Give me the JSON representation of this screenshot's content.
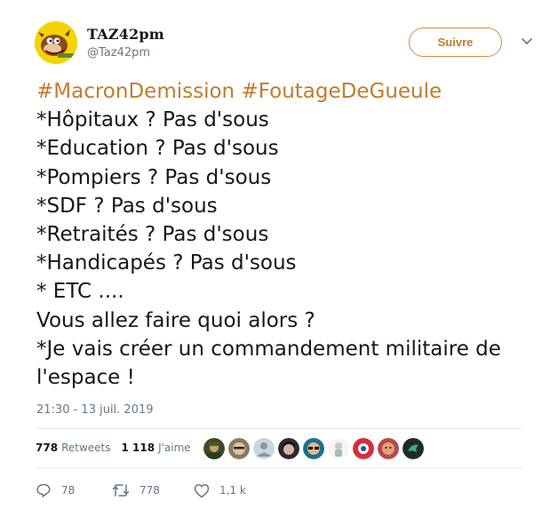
{
  "user": {
    "display_name": "TAZ42pm",
    "handle": "@Taz42pm"
  },
  "follow_button": {
    "label": "Suivre"
  },
  "tweet": {
    "hashtags": [
      "#MacronDemission",
      "#FoutageDeGueule"
    ],
    "lines": [
      "*Hôpitaux ? Pas d'sous",
      "*Education ? Pas d'sous",
      "*Pompiers ? Pas d'sous",
      "*SDF ? Pas d'sous",
      "*Retraités ? Pas d'sous",
      "*Handicapés ? Pas d'sous",
      "* ETC ....",
      "Vous allez faire quoi alors ?",
      "*Je vais créer un commandement militaire de",
      "l'espace !"
    ],
    "timestamp": "21:30 - 13 juil. 2019"
  },
  "stats": {
    "retweets_count": "778",
    "retweets_label": "Retweets",
    "likes_count": "1 118",
    "likes_label": "J'aime"
  },
  "actions": {
    "reply_count": "78",
    "retweet_count": "778",
    "like_count": "1,1 k"
  },
  "colors": {
    "hashtag": "#c17c2b",
    "follow_border": "#cc8e3f",
    "secondary_text": "#657786",
    "avatar_bg": "#f3d400"
  },
  "likers": [
    {
      "icon": "avatar-soldier"
    },
    {
      "icon": "avatar-face-glasses"
    },
    {
      "icon": "avatar-default"
    },
    {
      "icon": "avatar-dark-hair"
    },
    {
      "icon": "avatar-sunglasses"
    },
    {
      "icon": "avatar-white-figure"
    },
    {
      "icon": "avatar-red-circle"
    },
    {
      "icon": "avatar-pink-face"
    },
    {
      "icon": "avatar-bird"
    }
  ]
}
